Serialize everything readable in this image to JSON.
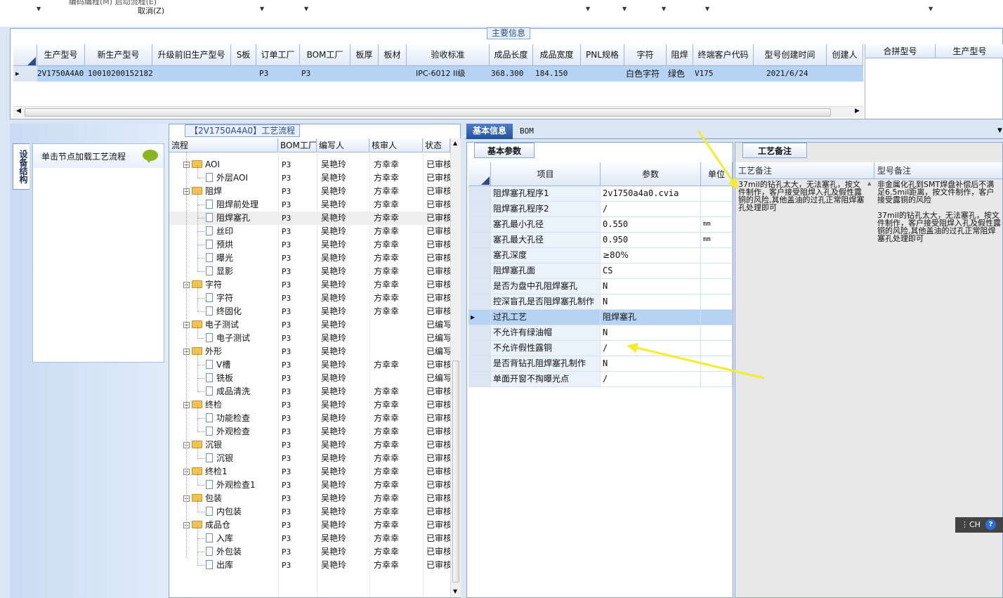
{
  "topbar": {
    "cancel_label": "取消(Z)",
    "cut_text": "编码编程(M)  启动流程(E)"
  },
  "main_panel": {
    "title": "主要信息",
    "columns": [
      "生产型号",
      "新生产型号",
      "升级前旧生产型号",
      "S板",
      "订单工厂",
      "BOM工厂",
      "板厚",
      "板材",
      "验收标准",
      "成品长度",
      "成品宽度",
      "PNL规格",
      "字符",
      "阻焊",
      "终端客户代码",
      "型号创建时间",
      "创建人"
    ],
    "row": [
      "2V1750A4A0",
      "10010200152182",
      "",
      "",
      "P3",
      "P3",
      "",
      "",
      "IPC-6012 II级",
      "368.300",
      "184.150",
      "",
      "白色字符",
      "绿色",
      "V175",
      "2021/6/24",
      ""
    ],
    "right_columns": [
      "合拼型号",
      "生产型号"
    ]
  },
  "left_panel": {
    "vertical_tab": "设备结构",
    "load_text": "单击节点加载工艺流程"
  },
  "tree": {
    "title": "【2V1750A4A0】工艺流程",
    "columns": [
      "流程",
      "BOM工厂",
      "编写人",
      "核审人",
      "状态"
    ],
    "rows": [
      {
        "name": "AOI",
        "folder": true,
        "bom": "P3",
        "writer": "吴艳玲",
        "reviewer": "方幸幸",
        "status": "已审核"
      },
      {
        "name": "外层AOI",
        "folder": false,
        "bom": "P3",
        "writer": "吴艳玲",
        "reviewer": "方幸幸",
        "status": "已审核"
      },
      {
        "name": "阻焊",
        "folder": true,
        "bom": "P3",
        "writer": "吴艳玲",
        "reviewer": "方幸幸",
        "status": "已审核"
      },
      {
        "name": "阻焊前处理",
        "folder": false,
        "bom": "P3",
        "writer": "吴艳玲",
        "reviewer": "方幸幸",
        "status": "已审核"
      },
      {
        "name": "阻焊塞孔",
        "folder": false,
        "bom": "P3",
        "writer": "吴艳玲",
        "reviewer": "方幸幸",
        "status": "已审核",
        "selected": true
      },
      {
        "name": "丝印",
        "folder": false,
        "bom": "P3",
        "writer": "吴艳玲",
        "reviewer": "方幸幸",
        "status": "已审核"
      },
      {
        "name": "预烘",
        "folder": false,
        "bom": "P3",
        "writer": "吴艳玲",
        "reviewer": "方幸幸",
        "status": "已审核"
      },
      {
        "name": "曝光",
        "folder": false,
        "bom": "P3",
        "writer": "吴艳玲",
        "reviewer": "方幸幸",
        "status": "已审核"
      },
      {
        "name": "显影",
        "folder": false,
        "bom": "P3",
        "writer": "吴艳玲",
        "reviewer": "方幸幸",
        "status": "已审核"
      },
      {
        "name": "字符",
        "folder": true,
        "bom": "P3",
        "writer": "吴艳玲",
        "reviewer": "方幸幸",
        "status": "已审核"
      },
      {
        "name": "字符",
        "folder": false,
        "bom": "P3",
        "writer": "吴艳玲",
        "reviewer": "方幸幸",
        "status": "已审核"
      },
      {
        "name": "终固化",
        "folder": false,
        "bom": "P3",
        "writer": "吴艳玲",
        "reviewer": "方幸幸",
        "status": "已审核"
      },
      {
        "name": "电子测试",
        "folder": true,
        "bom": "P3",
        "writer": "吴艳玲",
        "reviewer": "",
        "status": "已编写"
      },
      {
        "name": "电子测试",
        "folder": false,
        "bom": "P3",
        "writer": "吴艳玲",
        "reviewer": "",
        "status": "已编写"
      },
      {
        "name": "外形",
        "folder": true,
        "bom": "P3",
        "writer": "吴艳玲",
        "reviewer": "",
        "status": "已编写"
      },
      {
        "name": "V槽",
        "folder": false,
        "bom": "P3",
        "writer": "吴艳玲",
        "reviewer": "方幸幸",
        "status": "已审核"
      },
      {
        "name": "铣板",
        "folder": false,
        "bom": "P3",
        "writer": "吴艳玲",
        "reviewer": "",
        "status": "已编写"
      },
      {
        "name": "成品清洗",
        "folder": false,
        "bom": "P3",
        "writer": "吴艳玲",
        "reviewer": "方幸幸",
        "status": "已审核"
      },
      {
        "name": "终检",
        "folder": true,
        "bom": "P3",
        "writer": "吴艳玲",
        "reviewer": "方幸幸",
        "status": "已审核"
      },
      {
        "name": "功能检查",
        "folder": false,
        "bom": "P3",
        "writer": "吴艳玲",
        "reviewer": "方幸幸",
        "status": "已审核"
      },
      {
        "name": "外观检查",
        "folder": false,
        "bom": "P3",
        "writer": "吴艳玲",
        "reviewer": "方幸幸",
        "status": "已审核"
      },
      {
        "name": "沉银",
        "folder": true,
        "bom": "P3",
        "writer": "吴艳玲",
        "reviewer": "方幸幸",
        "status": "已审核"
      },
      {
        "name": "沉银",
        "folder": false,
        "bom": "P3",
        "writer": "吴艳玲",
        "reviewer": "方幸幸",
        "status": "已审核"
      },
      {
        "name": "终检1",
        "folder": true,
        "bom": "P3",
        "writer": "吴艳玲",
        "reviewer": "方幸幸",
        "status": "已审核"
      },
      {
        "name": "外观检查1",
        "folder": false,
        "bom": "P3",
        "writer": "吴艳玲",
        "reviewer": "方幸幸",
        "status": "已审核"
      },
      {
        "name": "包装",
        "folder": true,
        "bom": "P3",
        "writer": "吴艳玲",
        "reviewer": "方幸幸",
        "status": "已审核"
      },
      {
        "name": "内包装",
        "folder": false,
        "bom": "P3",
        "writer": "吴艳玲",
        "reviewer": "方幸幸",
        "status": "已审核"
      },
      {
        "name": "成品仓",
        "folder": true,
        "bom": "P3",
        "writer": "吴艳玲",
        "reviewer": "方幸幸",
        "status": "已审核"
      },
      {
        "name": "入库",
        "folder": false,
        "bom": "P3",
        "writer": "吴艳玲",
        "reviewer": "方幸幸",
        "status": "已审核"
      },
      {
        "name": "外包装",
        "folder": false,
        "bom": "P3",
        "writer": "吴艳玲",
        "reviewer": "方幸幸",
        "status": "已审核"
      },
      {
        "name": "出库",
        "folder": false,
        "bom": "P3",
        "writer": "吴艳玲",
        "reviewer": "方幸幸",
        "status": "已审核"
      }
    ]
  },
  "info": {
    "tab_basic": "基本信息",
    "tab_bom": "BOM",
    "params_tab": "基本参数",
    "params_columns": [
      "项目",
      "参数",
      "单位"
    ],
    "params": [
      {
        "item": "阻焊塞孔程序1",
        "value": "2v1750a4a0.cvia",
        "unit": ""
      },
      {
        "item": "阻焊塞孔程序2",
        "value": "/",
        "unit": ""
      },
      {
        "item": "塞孔最小孔径",
        "value": "0.550",
        "unit": "mm"
      },
      {
        "item": "塞孔最大孔径",
        "value": "0.950",
        "unit": "mm"
      },
      {
        "item": "塞孔深度",
        "value": "≥80%",
        "unit": ""
      },
      {
        "item": "阻焊塞孔面",
        "value": "CS",
        "unit": ""
      },
      {
        "item": "是否为盘中孔阻焊塞孔",
        "value": "N",
        "unit": ""
      },
      {
        "item": "控深盲孔是否阻焊塞孔制作",
        "value": "N",
        "unit": ""
      },
      {
        "item": "过孔工艺",
        "value": "阻焊塞孔",
        "unit": "",
        "selected": true
      },
      {
        "item": "不允许有绿油帽",
        "value": "N",
        "unit": ""
      },
      {
        "item": "不允许假性露铜",
        "value": "/",
        "unit": ""
      },
      {
        "item": "是否背钻孔阻焊塞孔制作",
        "value": "N",
        "unit": ""
      },
      {
        "item": "单面开窗不掏曝光点",
        "value": "/",
        "unit": ""
      }
    ],
    "notes_tab": "工艺备注",
    "notes_columns": [
      "工艺备注",
      "型号备注"
    ],
    "process_note": "37mil的钻孔太大，无法塞孔，按文件制作，客户接受阻焊入孔及假性露铜的风险,其他盖油的过孔正常阻焊塞孔处理即可",
    "model_note": "非金属化孔到SMT焊盘补偿后不满足6.5mil距离，按文件制作，客户接受露铜的风险\n\n37mil的钻孔太大，无法塞孔，按文件制作，客户接受阻焊入孔及假性露铜的风险,其他盖油的过孔正常阻焊塞孔处理即可"
  },
  "ime": {
    "label": "CH",
    "help": "?"
  },
  "colors": {
    "accent": "#24519c",
    "selection": "#b7d3f3",
    "annotation_arrow": "#f2ee2a"
  }
}
